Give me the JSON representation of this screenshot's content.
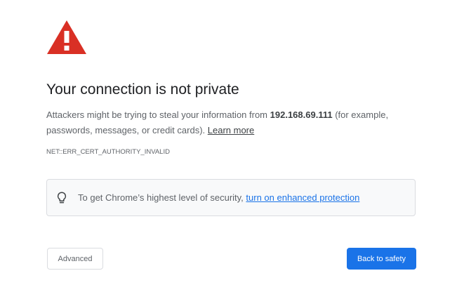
{
  "interstitial": {
    "icon": "warning-triangle-icon",
    "title": "Your connection is not private",
    "body_prefix": "Attackers might be trying to steal your information from ",
    "host": "192.168.69.111",
    "body_suffix": " (for example, passwords, messages, or credit cards). ",
    "learn_more": "Learn more",
    "error_code": "NET::ERR_CERT_AUTHORITY_INVALID"
  },
  "security_tip": {
    "icon": "lightbulb-icon",
    "text": "To get Chrome’s highest level of security, ",
    "link": "turn on enhanced protection"
  },
  "buttons": {
    "advanced": "Advanced",
    "back_to_safety": "Back to safety"
  },
  "colors": {
    "warning_red": "#d93025",
    "primary_blue": "#1a73e8",
    "text_gray": "#5f6368",
    "title_dark": "#202124"
  }
}
